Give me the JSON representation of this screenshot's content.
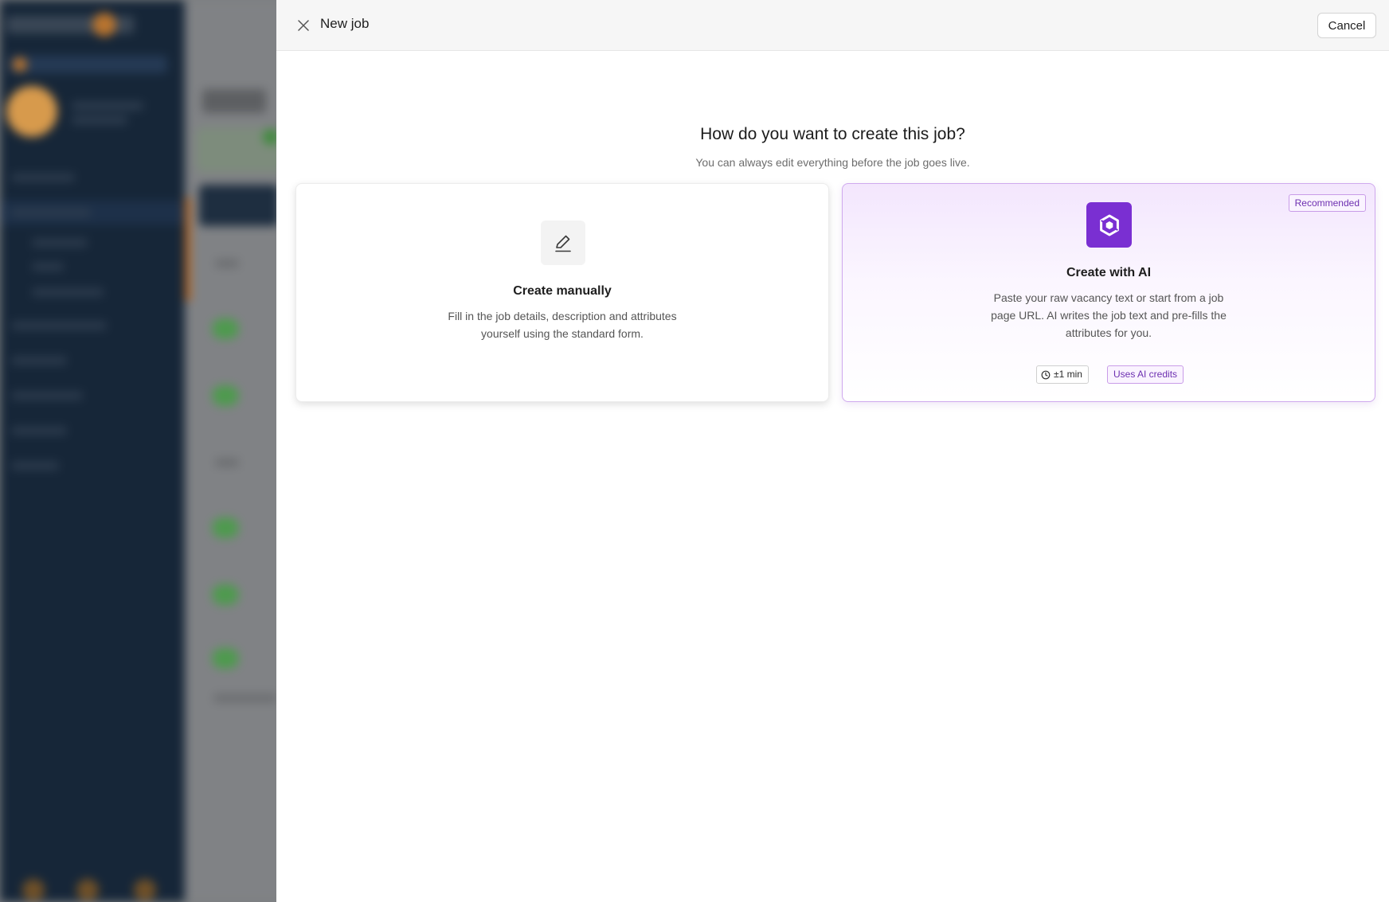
{
  "drawer": {
    "title": "New job",
    "cancel_label": "Cancel"
  },
  "chooser": {
    "heading": "How do you want to create this job?",
    "subheading": "You can always edit everything before the job goes live."
  },
  "options": {
    "manual": {
      "title": "Create manually",
      "description": "Fill in the job details, description and attributes yourself using the standard form.",
      "icon": "pencil-icon"
    },
    "ai": {
      "badge": "Recommended",
      "title": "Create with AI",
      "description": "Paste your raw vacancy text or start from a job page URL. AI writes the job text and pre-fills the attributes for you.",
      "icon": "ai-logo-icon",
      "time_chip": "±1 min",
      "credits_chip": "Uses AI credits"
    }
  },
  "colors": {
    "accent_purple": "#7a2fd2",
    "ai_border": "#cfa9ee",
    "sidebar_bg": "#162638"
  }
}
